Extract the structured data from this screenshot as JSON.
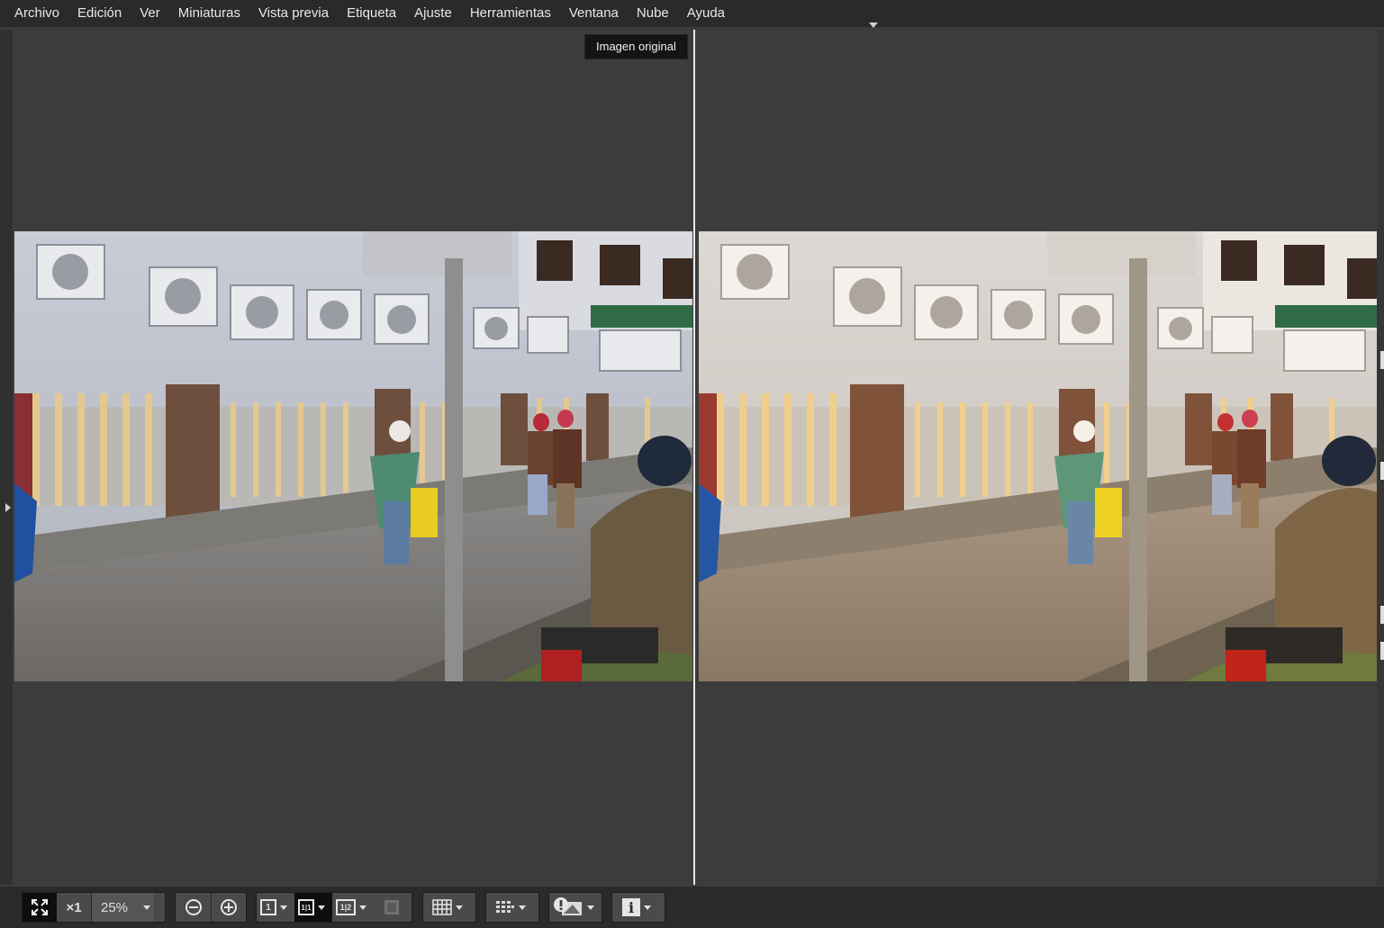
{
  "menu": [
    "Archivo",
    "Edición",
    "Ver",
    "Miniaturas",
    "Vista previa",
    "Etiqueta",
    "Ajuste",
    "Herramientas",
    "Ventana",
    "Nube",
    "Ayuda"
  ],
  "viewer": {
    "left_pane_label": "Imagen original"
  },
  "toolbar": {
    "fit_icon": "fit-to-screen-icon",
    "actual_size_label": "×1",
    "zoom_value": "25%",
    "zoom_out_icon": "zoom-out-icon",
    "zoom_in_icon": "zoom-in-icon",
    "single_view_label": "1",
    "compare_view_label": "1|1",
    "two_image_label": "1|2",
    "grid_icon": "grid-icon",
    "focus_points_icon": "focus-points-icon",
    "highlight_warning_icon": "highlight-warning-icon",
    "info_label": "i"
  }
}
